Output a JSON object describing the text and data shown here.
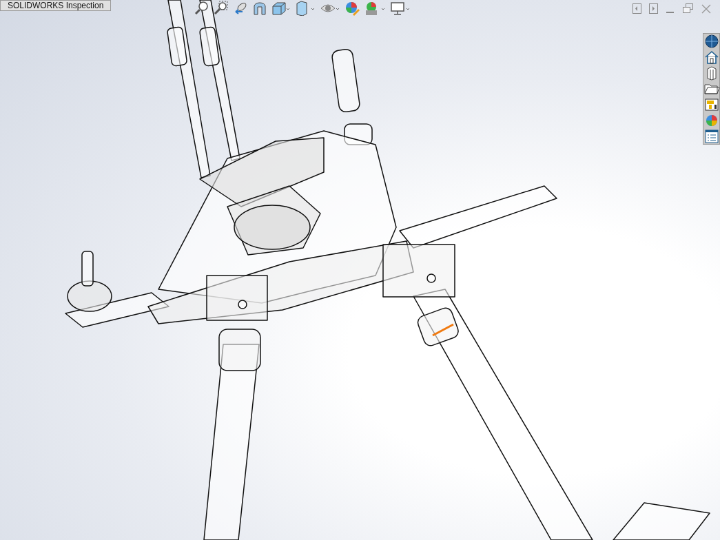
{
  "tab": {
    "label": "SOLIDWORKS Inspection"
  }
}
